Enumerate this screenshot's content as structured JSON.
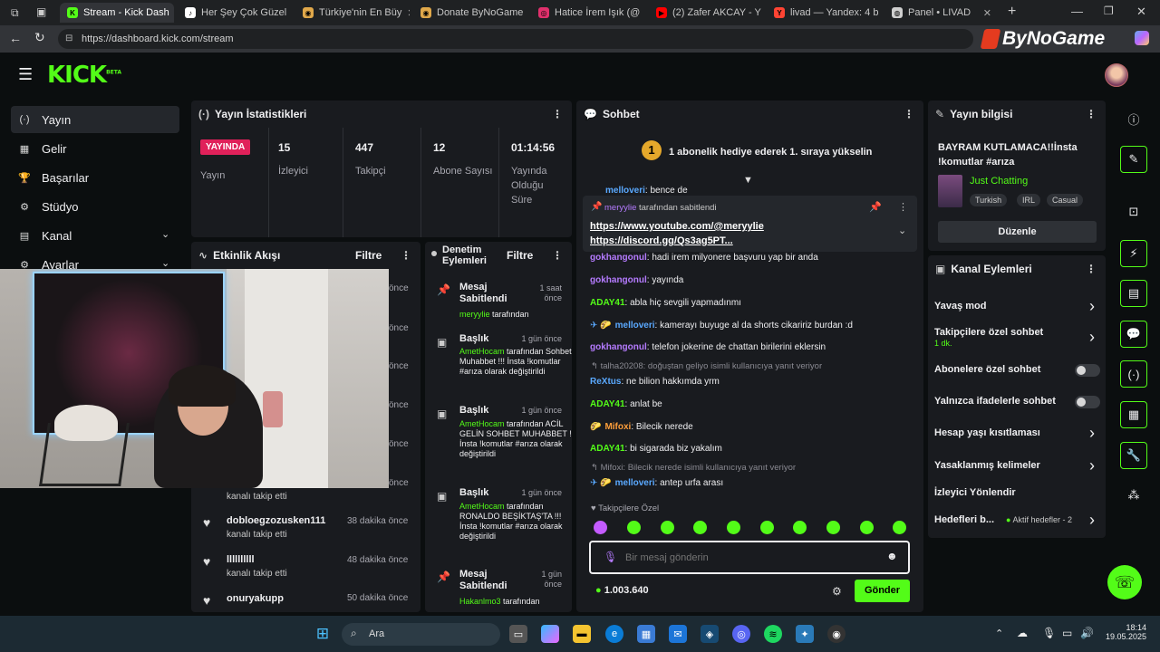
{
  "browser": {
    "tabs": [
      {
        "label": "Stream - Kick Dash",
        "fav_color": "#53fc18",
        "fav_text": "K"
      },
      {
        "label": "Her Şey Çok Güzel",
        "fav_color": "#ffffff",
        "fav_text": "♪"
      },
      {
        "label": "Türkiye'nin En Büy",
        "fav_color": "#e0a84a",
        "fav_text": "◉"
      },
      {
        "label": "Donate ByNoGame",
        "fav_color": "#e0a84a",
        "fav_text": "◉"
      },
      {
        "label": "Hatice İrem Işık (@",
        "fav_color": "#e1306c",
        "fav_text": "◎"
      },
      {
        "label": "(2) Zafer AKCAY - Y",
        "fav_color": "#ff0000",
        "fav_text": "▶"
      },
      {
        "label": "livad — Yandex: 4 b",
        "fav_color": "#ff4433",
        "fav_text": "Y"
      },
      {
        "label": "Panel • LIVAD",
        "fav_color": "#cfcfcf",
        "fav_text": "◍"
      }
    ],
    "url": "https://dashboard.kick.com/stream",
    "brand_overlay": "ByNoGame"
  },
  "kick": {
    "logo": "KICK",
    "logo_badge": "BETA",
    "accent": "#53fc18"
  },
  "sidebar": {
    "items": [
      {
        "label": "Yayın",
        "icon": "broadcast-icon",
        "glyph": "(·)"
      },
      {
        "label": "Gelir",
        "icon": "revenue-icon",
        "glyph": "▦"
      },
      {
        "label": "Başarılar",
        "icon": "trophy-icon",
        "glyph": "🏆"
      },
      {
        "label": "Stüdyo",
        "icon": "studio-icon",
        "glyph": "⚙"
      },
      {
        "label": "Kanal",
        "icon": "channel-icon",
        "glyph": "▤"
      },
      {
        "label": "Ayarlar",
        "icon": "settings-icon",
        "glyph": "⚙"
      }
    ]
  },
  "stats": {
    "title": "Yayın İstatistikleri",
    "live_badge": "YAYINDA",
    "live_label": "Yayın",
    "items": [
      {
        "value": "15",
        "label": "İzleyici"
      },
      {
        "value": "447",
        "label": "Takipçi"
      },
      {
        "value": "12",
        "label": "Abone Sayısı"
      },
      {
        "value": "01:14:56",
        "label": "Yayında Olduğu Süre"
      }
    ]
  },
  "activity": {
    "title": "Etkinlik Akışı",
    "filter": "Filtre",
    "partial_times": [
      "önce",
      "önce",
      "önce",
      "önce",
      "önce",
      "önce"
    ],
    "partial_sub": "kanalı takip etti",
    "items": [
      {
        "user": "dobloegzozusken111",
        "sub": "kanalı takip etti",
        "time": "38 dakika önce"
      },
      {
        "user": "llllllllll",
        "sub": "kanalı takip etti",
        "time": "48 dakika önce"
      },
      {
        "user": "onuryakupp",
        "sub": "",
        "time": "50 dakika önce"
      }
    ]
  },
  "moderation": {
    "title": "Denetim Eylemleri",
    "filter": "Filtre",
    "items": [
      {
        "title": "Mesaj Sabitlendi",
        "time": "1 saat önce",
        "user": "meryylie",
        "rest": " tarafından",
        "extra": ""
      },
      {
        "title": "Başlık",
        "time": "1 gün önce",
        "user": "AmetHocam",
        "rest": " tarafından Sohbet Muhabbet !!! İnsta !komutlar #arıza olarak değiştirildi",
        "extra": ""
      },
      {
        "title": "Başlık",
        "time": "1 gün önce",
        "user": "AmetHocam",
        "rest": " tarafından ACİL GELİN SOHBET MUHABBET !!!İnsta !komutlar #arıza olarak değiştirildi",
        "extra": ""
      },
      {
        "title": "Başlık",
        "time": "1 gün önce",
        "user": "AmetHocam",
        "rest": " tarafından RONALDO BEŞİKTAŞ'TA !!!İnsta !komutlar #arıza olarak değiştirildi",
        "extra": ""
      },
      {
        "title": "Mesaj Sabitlendi",
        "time": "1 gün önce",
        "user": "Hakanlmo3",
        "rest": " tarafından",
        "extra": ""
      }
    ]
  },
  "chat": {
    "title": "Sohbet",
    "gift_banner": "1 abonelik hediye ederek 1. sıraya yükselin",
    "partial_line": {
      "user": "melloveri",
      "text": ": bence de"
    },
    "pinned": {
      "user": "meryylie",
      "by": " tarafından sabitlendi",
      "line1": "https://www.youtube.com/@meryylie",
      "line2": "https://discord.gg/Qs3ag5PT..."
    },
    "messages": [
      {
        "user": "gokhangonul",
        "text": ": hadi irem milyonere başvuru yap bir anda",
        "color": "#b57bff",
        "badges": "",
        "reply": ""
      },
      {
        "user": "gokhangonul",
        "text": ": yayında",
        "color": "#b57bff",
        "badges": "",
        "reply": ""
      },
      {
        "user": "ADAY41",
        "text": ": abla hiç sevgili yapmadınmı",
        "color": "#53fc18",
        "badges": "",
        "reply": ""
      },
      {
        "user": "melloveri",
        "text": ": kamerayı buyuge al da shorts cikaririz burdan :d",
        "color": "#5aa9ff",
        "badges": "✈ 🌮",
        "reply": ""
      },
      {
        "user": "gokhangonul",
        "text": ": telefon jokerine de chattan birilerini eklersin",
        "color": "#b57bff",
        "badges": "",
        "reply": ""
      },
      {
        "user": "ReXtus",
        "text": ": ne bilion hakkımda yrm",
        "color": "#5aa9ff",
        "badges": "",
        "reply": "talha20208: doğuştan geliyo isimli kullanıcıya yanıt veriyor"
      },
      {
        "user": "ADAY41",
        "text": ": anlat be",
        "color": "#53fc18",
        "badges": "",
        "reply": ""
      },
      {
        "user": "Mifoxi",
        "text": ": Bilecik nerede",
        "color": "#ff9f3a",
        "badges": "🌮",
        "reply": ""
      },
      {
        "user": "ADAY41",
        "text": ": bi sigarada biz yakalım",
        "color": "#53fc18",
        "badges": "",
        "reply": ""
      },
      {
        "user": "melloveri",
        "text": ": antep urfa arası",
        "color": "#5aa9ff",
        "badges": "✈ 🌮",
        "reply": "Mifoxi: Bilecik nerede isimli kullanıcıya yanıt veriyor"
      }
    ],
    "followers_only": "Takipçilere Özel",
    "input_placeholder": "Bir mesaj gönderin",
    "balance": "1.003.640",
    "send": "Gönder"
  },
  "stream_info": {
    "title": "Yayın bilgisi",
    "stream_title": "BAYRAM KUTLAMACA!!İnsta !komutlar #arıza",
    "category": "Just Chatting",
    "tags": [
      "Turkish",
      "IRL",
      "Casual"
    ],
    "edit": "Düzenle"
  },
  "channel_actions": {
    "title": "Kanal Eylemleri",
    "rows": [
      {
        "label": "Yavaş mod",
        "kind": "chevron",
        "sub": ""
      },
      {
        "label": "Takipçilere özel sohbet",
        "kind": "chevron",
        "sub": "1 dk."
      },
      {
        "label": "Abonelere özel sohbet",
        "kind": "toggle",
        "sub": ""
      },
      {
        "label": "Yalnızca ifadelerle sohbet",
        "kind": "toggle",
        "sub": ""
      },
      {
        "label": "Hesap yaşı kısıtlaması",
        "kind": "chevron",
        "sub": ""
      },
      {
        "label": "Yasaklanmış kelimeler",
        "kind": "chevron",
        "sub": ""
      },
      {
        "label": "İzleyici Yönlendir",
        "kind": "none",
        "sub": ""
      },
      {
        "label": "Hedefleri b...",
        "kind": "chevron",
        "sub": "Aktif hedefler - 2"
      }
    ]
  },
  "taskbar": {
    "search": "Ara",
    "time": "18:14",
    "date": "19.05.2025"
  }
}
